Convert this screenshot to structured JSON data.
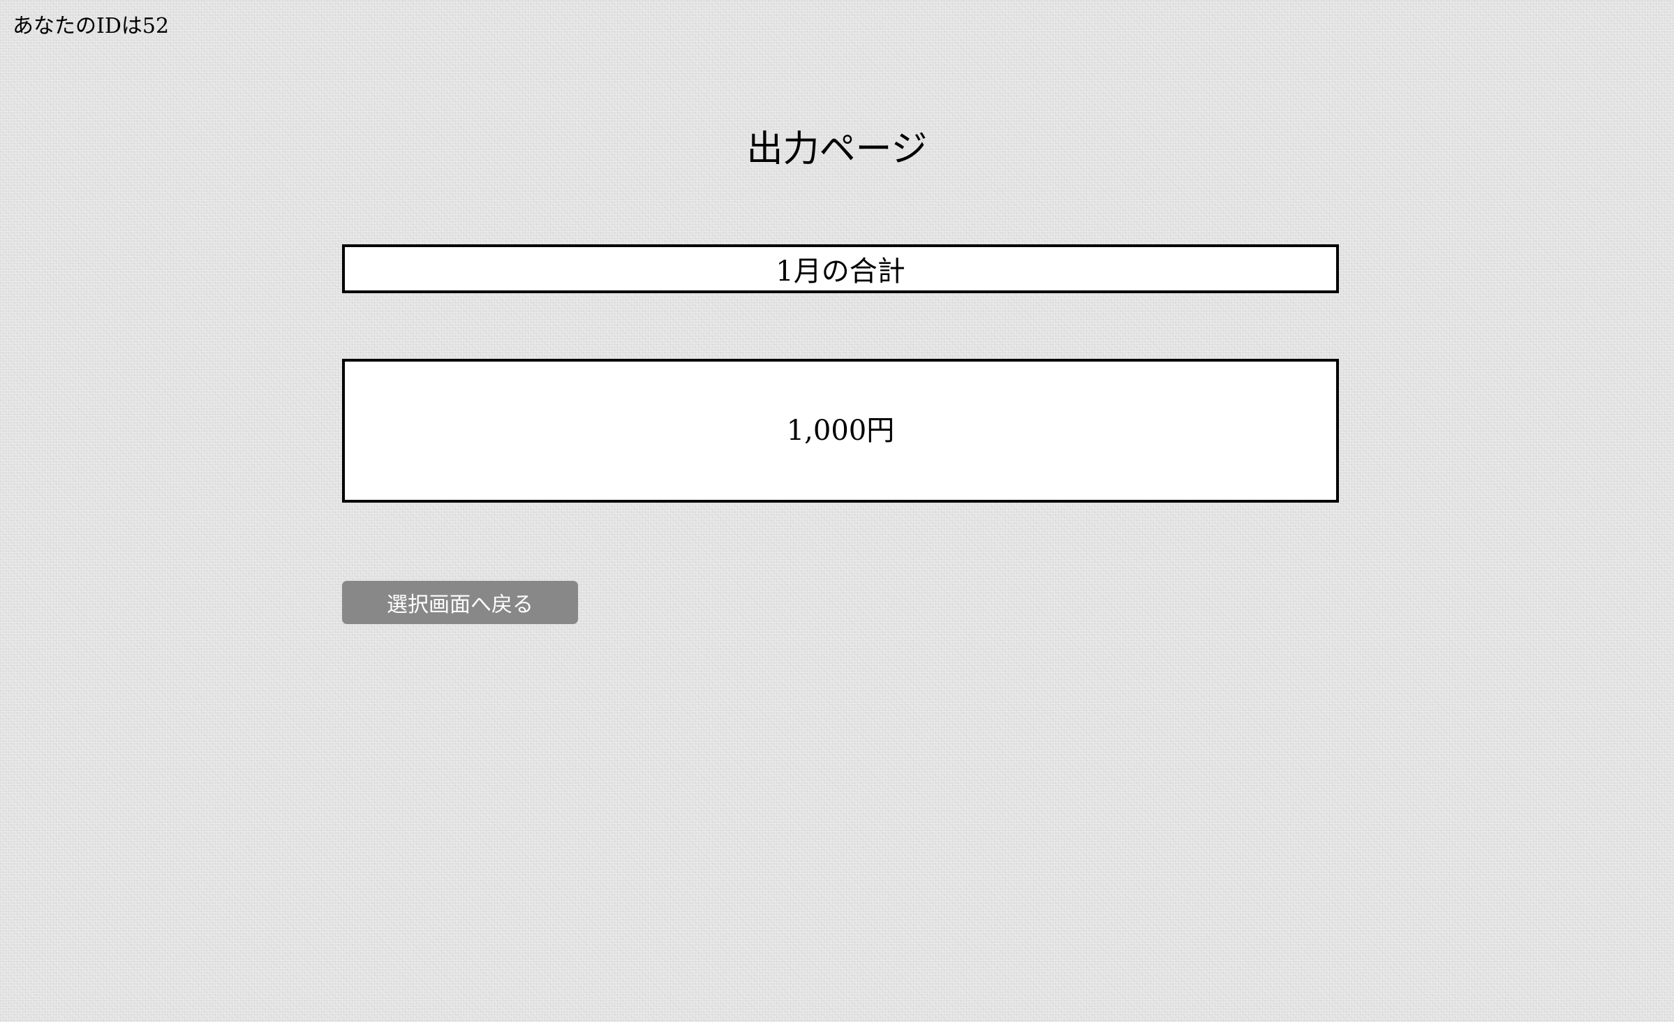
{
  "header": {
    "user_id_text": "あなたのIDは52"
  },
  "main": {
    "title": "出力ページ",
    "month_label": "1月の合計",
    "total_amount": "1,000円",
    "back_button_label": "選択画面へ戻る"
  }
}
